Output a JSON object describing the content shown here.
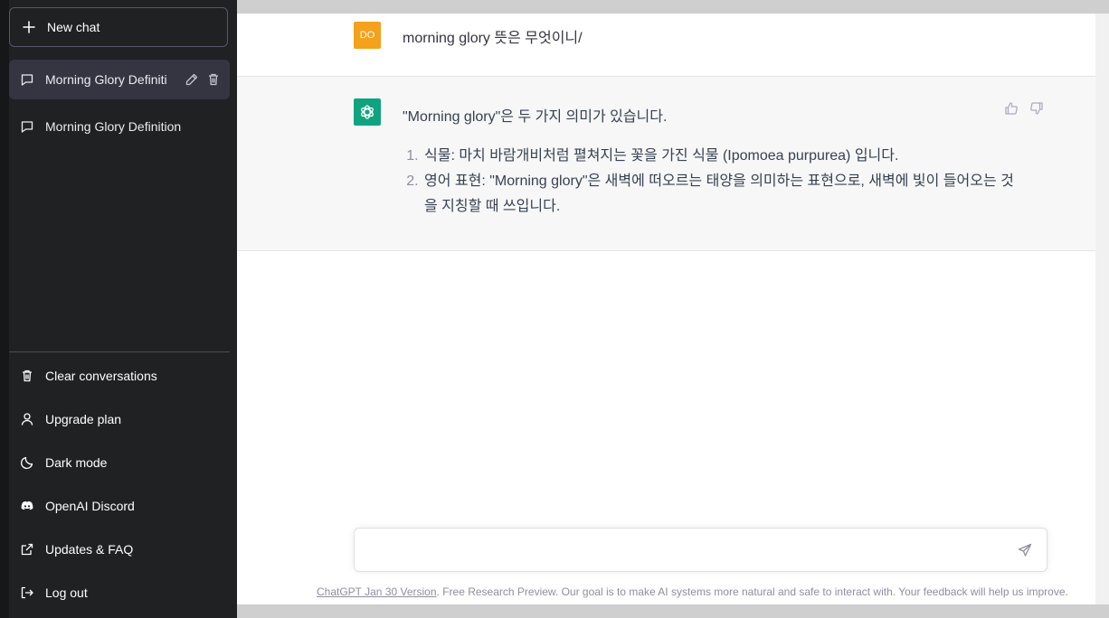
{
  "sidebar": {
    "new_chat_label": "New chat",
    "conversations": [
      {
        "title": "Morning Glory Definiti"
      },
      {
        "title": "Morning Glory Definition"
      }
    ],
    "menu": {
      "clear": "Clear conversations",
      "upgrade": "Upgrade plan",
      "dark": "Dark mode",
      "discord": "OpenAI Discord",
      "updates": "Updates & FAQ",
      "logout": "Log out"
    }
  },
  "chat": {
    "user_initials": "DO",
    "user_message": "morning glory 뜻은 무엇이니/",
    "assistant_intro": "\"Morning glory\"은 두 가지 의미가 있습니다.",
    "assistant_list": [
      "식물: 마치 바람개비처럼 펼쳐지는 꽃을 가진 식물 (Ipomoea purpurea) 입니다.",
      "영어 표현: \"Morning glory\"은 새벽에 떠오르는 태양을 의미하는 표현으로, 새벽에 빛이 들어오는 것을 지칭할 때 쓰입니다."
    ]
  },
  "input": {
    "placeholder": ""
  },
  "footer": {
    "version_link": "ChatGPT Jan 30 Version",
    "text": ". Free Research Preview. Our goal is to make AI systems more natural and safe to interact with. Your feedback will help us improve."
  },
  "colors": {
    "sidebar_bg": "#202123",
    "active_item_bg": "#343541",
    "user_avatar": "#f4a11b",
    "assistant_avatar": "#10a37f",
    "assistant_row_bg": "#f7f7f8"
  }
}
